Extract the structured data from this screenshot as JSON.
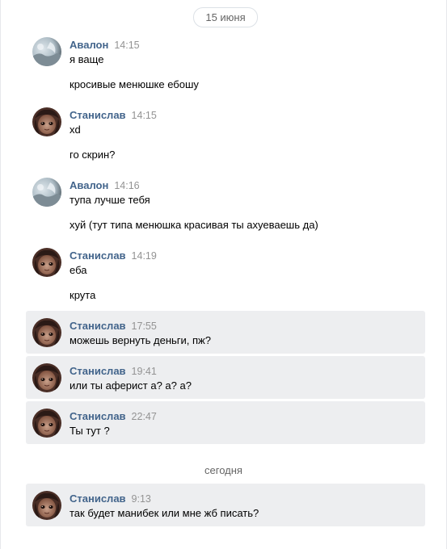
{
  "chat": {
    "date_top": "15 июня",
    "today_label": "сегодня",
    "messages": [
      {
        "author": "Авалон",
        "time": "14:15",
        "lines": [
          "я ваще",
          "кросивые менюшке ебошу"
        ]
      },
      {
        "author": "Станислав",
        "time": "14:15",
        "lines": [
          "xd",
          "го скрин?"
        ]
      },
      {
        "author": "Авалон",
        "time": "14:16",
        "lines": [
          "тупа лучше тебя",
          "хуй (тут типа менюшка красивая ты ахуеваешь да)"
        ]
      },
      {
        "author": "Станислав",
        "time": "14:19",
        "lines": [
          "еба",
          "крута"
        ]
      },
      {
        "author": "Станислав",
        "time": "17:55",
        "lines": [
          "можешь вернуть деньги, пж?"
        ]
      },
      {
        "author": "Станислав",
        "time": "19:41",
        "lines": [
          "или ты аферист а? а? а?"
        ]
      },
      {
        "author": "Станислав",
        "time": "22:47",
        "lines": [
          "Ты тут ?"
        ]
      },
      {
        "author": "Станислав",
        "time": "9:13",
        "lines": [
          "так будет манибек или мне жб писать?"
        ]
      }
    ]
  },
  "colors": {
    "author_name": "#42648b",
    "timestamp": "#939393",
    "highlight_bg": "#edeef0"
  },
  "icons": {
    "avalon_avatar": "avatar-avalon-icon",
    "stanislav_avatar": "avatar-stanislav-icon"
  }
}
